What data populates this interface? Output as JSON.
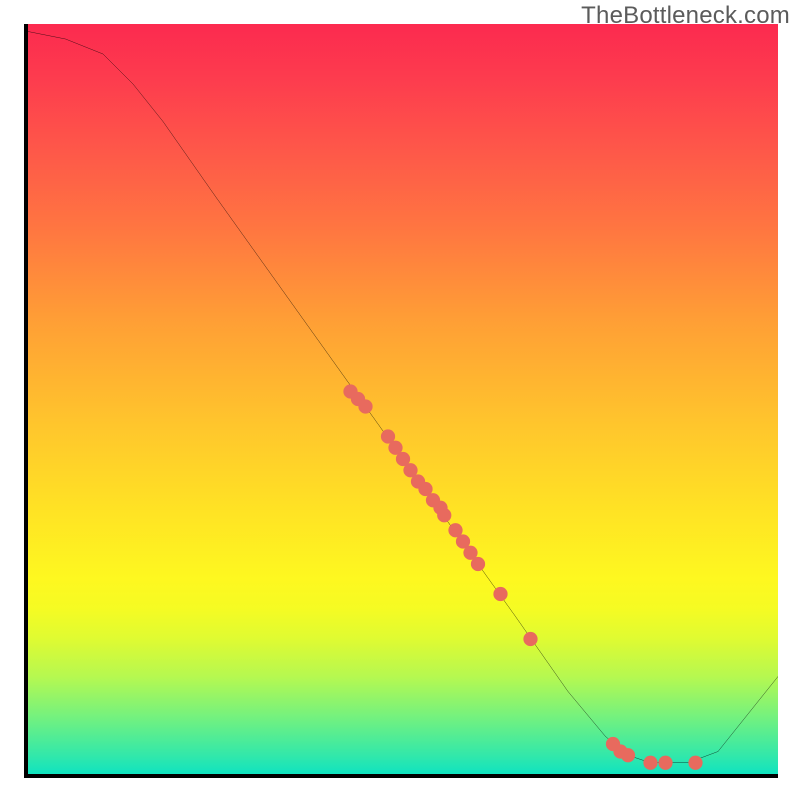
{
  "watermark": "TheBottleneck.com",
  "chart_data": {
    "type": "line",
    "title": "",
    "xlabel": "",
    "ylabel": "",
    "xlim": [
      0,
      100
    ],
    "ylim": [
      0,
      100
    ],
    "curve": [
      {
        "x": 0,
        "y": 99
      },
      {
        "x": 5,
        "y": 98
      },
      {
        "x": 10,
        "y": 96
      },
      {
        "x": 14,
        "y": 92
      },
      {
        "x": 18,
        "y": 87
      },
      {
        "x": 25,
        "y": 77
      },
      {
        "x": 35,
        "y": 63
      },
      {
        "x": 45,
        "y": 49
      },
      {
        "x": 55,
        "y": 35
      },
      {
        "x": 65,
        "y": 21
      },
      {
        "x": 72,
        "y": 11
      },
      {
        "x": 77,
        "y": 5
      },
      {
        "x": 80,
        "y": 2.5
      },
      {
        "x": 83,
        "y": 1.5
      },
      {
        "x": 88,
        "y": 1.5
      },
      {
        "x": 92,
        "y": 3
      },
      {
        "x": 96,
        "y": 8
      },
      {
        "x": 100,
        "y": 13
      }
    ],
    "markers": [
      {
        "x": 43,
        "y": 51
      },
      {
        "x": 44,
        "y": 50
      },
      {
        "x": 45,
        "y": 49
      },
      {
        "x": 48,
        "y": 45
      },
      {
        "x": 49,
        "y": 43.5
      },
      {
        "x": 50,
        "y": 42
      },
      {
        "x": 51,
        "y": 40.5
      },
      {
        "x": 52,
        "y": 39
      },
      {
        "x": 53,
        "y": 38
      },
      {
        "x": 54,
        "y": 36.5
      },
      {
        "x": 55,
        "y": 35.5
      },
      {
        "x": 55.5,
        "y": 34.5
      },
      {
        "x": 57,
        "y": 32.5
      },
      {
        "x": 58,
        "y": 31
      },
      {
        "x": 59,
        "y": 29.5
      },
      {
        "x": 60,
        "y": 28
      },
      {
        "x": 63,
        "y": 24
      },
      {
        "x": 67,
        "y": 18
      },
      {
        "x": 78,
        "y": 4
      },
      {
        "x": 79,
        "y": 3
      },
      {
        "x": 80,
        "y": 2.5
      },
      {
        "x": 83,
        "y": 1.5
      },
      {
        "x": 85,
        "y": 1.5
      },
      {
        "x": 89,
        "y": 1.5
      }
    ],
    "marker_color": "#e86a5e",
    "curve_color": "#000000"
  }
}
